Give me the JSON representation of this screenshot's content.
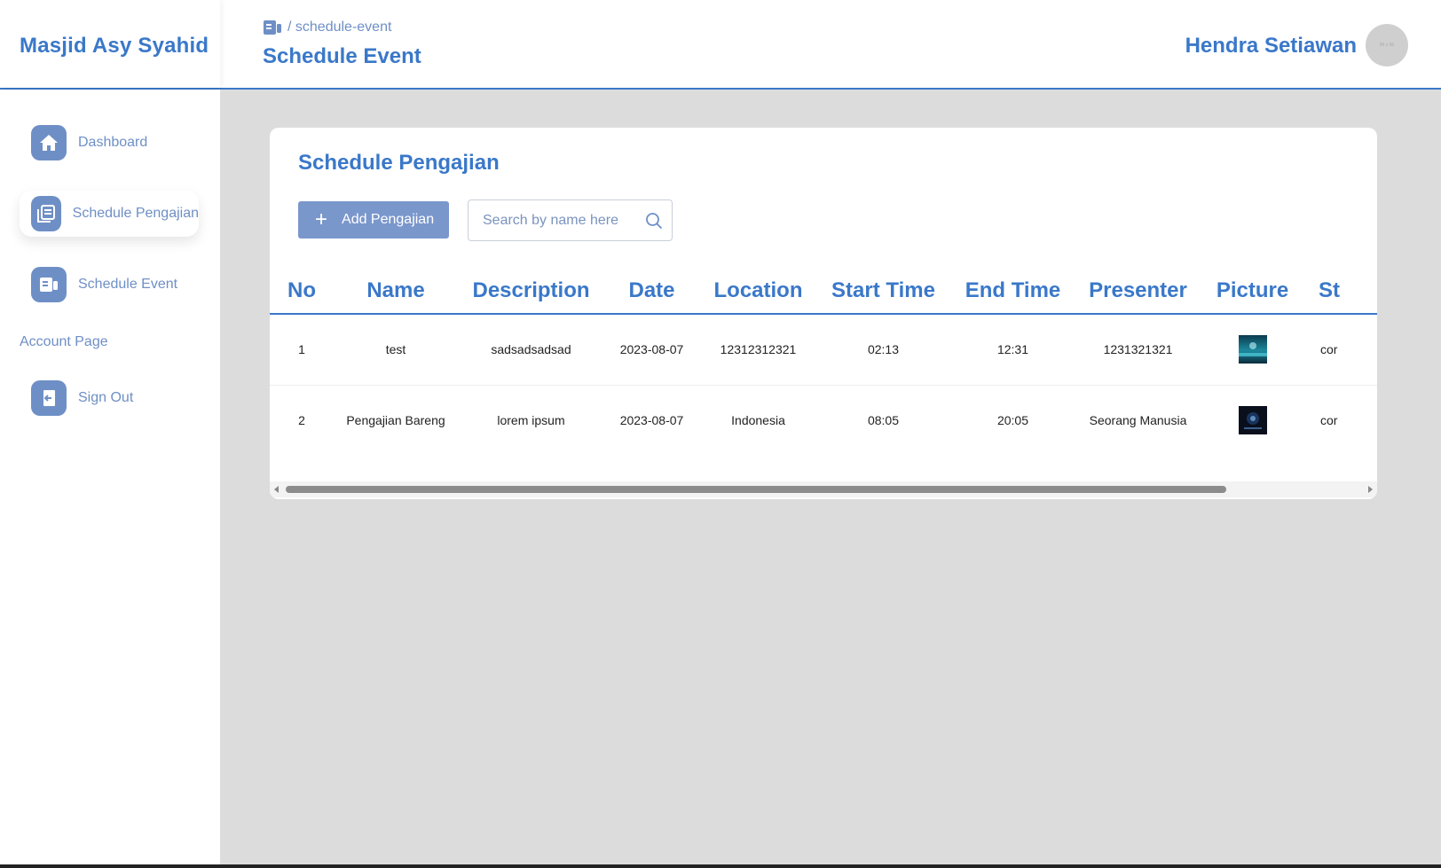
{
  "app": {
    "brand": "Masjid Asy Syahid"
  },
  "header": {
    "breadcrumb": "/ schedule-event",
    "title": "Schedule Event",
    "user_name": "Hendra Setiawan",
    "avatar_text": "96 x 96"
  },
  "sidebar": {
    "items": [
      {
        "label": "Dashboard",
        "icon": "home-icon"
      },
      {
        "label": "Schedule Pengajian",
        "icon": "document-list-icon",
        "active": true
      },
      {
        "label": "Schedule Event",
        "icon": "event-icon"
      }
    ],
    "section_label": "Account Page",
    "signout": {
      "label": "Sign Out",
      "icon": "sign-out-icon"
    }
  },
  "card": {
    "title": "Schedule Pengajian",
    "add_button": "Add Pengajian",
    "search_placeholder": "Search by name here"
  },
  "table": {
    "columns": [
      "No",
      "Name",
      "Description",
      "Date",
      "Location",
      "Start Time",
      "End Time",
      "Presenter",
      "Picture",
      "St"
    ],
    "rows": [
      {
        "no": "1",
        "name": "test",
        "description": "sadsadsadsad",
        "date": "2023-08-07",
        "location": "12312312321",
        "start_time": "02:13",
        "end_time": "12:31",
        "presenter": "1231321321",
        "picture": "thumbnail-image",
        "status": "cor"
      },
      {
        "no": "2",
        "name": "Pengajian Bareng",
        "description": "lorem ipsum",
        "date": "2023-08-07",
        "location": "Indonesia",
        "start_time": "08:05",
        "end_time": "20:05",
        "presenter": "Seorang Manusia",
        "picture": "thumbnail-image",
        "status": "cor"
      }
    ]
  },
  "colors": {
    "primary": "#3a78c9",
    "accent": "#6e8fc6",
    "button": "#7a97cc",
    "background": "#dcdcdc"
  }
}
